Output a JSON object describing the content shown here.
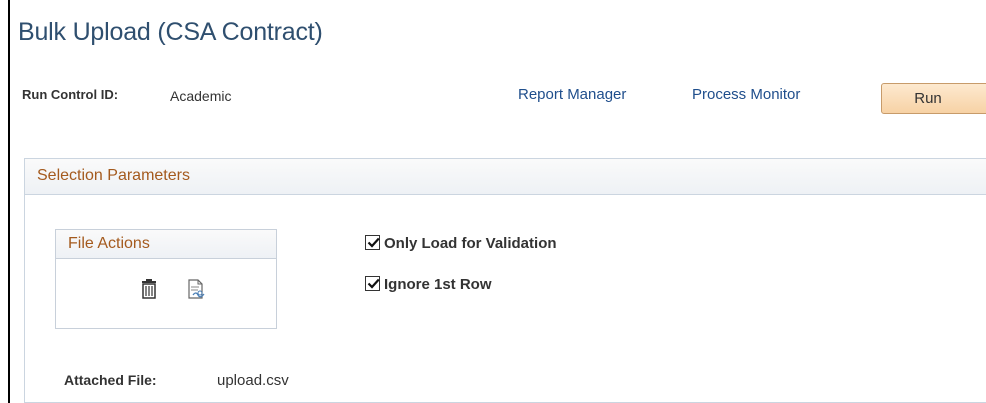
{
  "page": {
    "title": "Bulk Upload (CSA Contract)"
  },
  "run_control": {
    "label": "Run Control ID:",
    "value": "Academic"
  },
  "links": {
    "report_manager": "Report Manager",
    "process_monitor": "Process Monitor"
  },
  "buttons": {
    "run_label": "Run"
  },
  "selection_parameters": {
    "header": "Selection Parameters",
    "file_actions": {
      "header": "File Actions",
      "icons": [
        "trash-icon",
        "view-document-icon"
      ]
    },
    "options": [
      {
        "label": "Only Load for Validation",
        "checked": true
      },
      {
        "label": "Ignore 1st Row",
        "checked": true
      }
    ],
    "attached_file": {
      "label": "Attached File:",
      "value": "upload.csv"
    }
  },
  "colors": {
    "title": "#2f4f6f",
    "link": "#1f4e8c",
    "section_header_text": "#a45a1e",
    "run_button_bg": "#f7d2a5",
    "border": "#cbd5e0"
  }
}
